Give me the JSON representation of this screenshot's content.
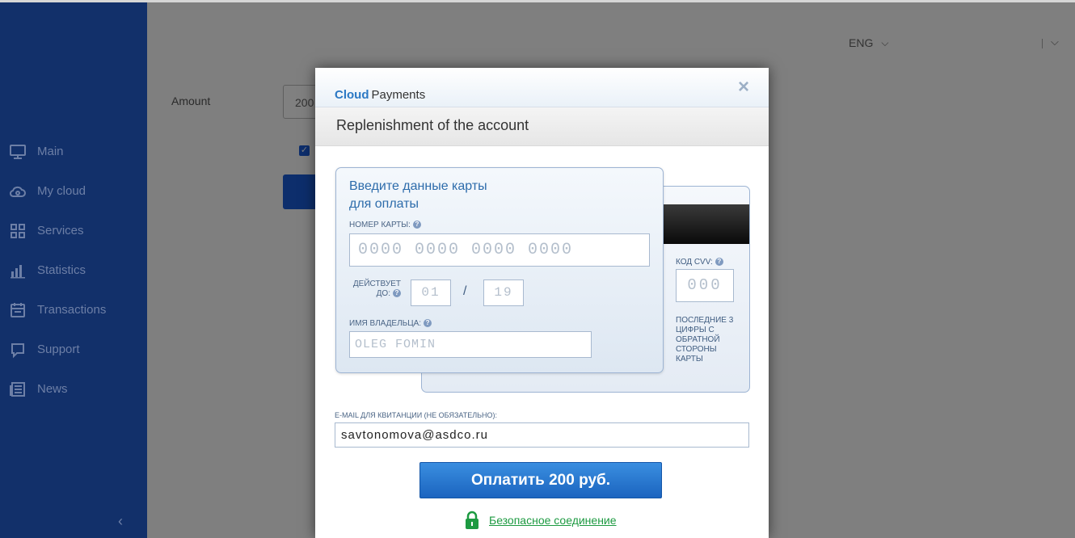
{
  "sidebar": {
    "items": [
      {
        "label": "Main",
        "icon": "monitor-icon"
      },
      {
        "label": "My cloud",
        "icon": "cloud-icon"
      },
      {
        "label": "Services",
        "icon": "grid-icon"
      },
      {
        "label": "Statistics",
        "icon": "bar-chart-icon"
      },
      {
        "label": "Transactions",
        "icon": "calendar-icon"
      },
      {
        "label": "Support",
        "icon": "chat-icon"
      },
      {
        "label": "News",
        "icon": "newspaper-icon"
      }
    ],
    "collapse_glyph": "‹"
  },
  "header": {
    "language": "ENG",
    "chevron": "⌵"
  },
  "form": {
    "amount_label": "Amount",
    "amount_value": "200",
    "check_glyph": "✓"
  },
  "modal": {
    "brand_cloud": "Cloud",
    "brand_payments": "Payments",
    "close_glyph": "×",
    "title": "Replenishment of the account",
    "card_title_line1": "Введите данные карты",
    "card_title_line2": "для оплаты",
    "card_number_label": "НОМЕР КАРТЫ:",
    "card_number_placeholder": "0000 0000 0000 0000",
    "expiry_label_line1": "ДЕЙСТВУЕТ",
    "expiry_label_line2": "ДО:",
    "expiry_month_placeholder": "01",
    "expiry_year_placeholder": "19",
    "expiry_separator": "/",
    "holder_label": "ИМЯ ВЛАДЕЛЬЦА:",
    "holder_placeholder": "OLEG FOMIN",
    "cvv_label": "КОД CVV:",
    "cvv_placeholder": "000",
    "cvv_note": "ПОСЛЕДНИЕ 3 ЦИФРЫ С ОБРАТНОЙ СТОРОНЫ КАРТЫ",
    "help_glyph": "?",
    "email_label": "E-MAIL ДЛЯ КВИТАНЦИИ (НЕ ОБЯЗАТЕЛЬНО):",
    "email_value": "savtonomova@asdco.ru",
    "pay_button": "Оплатить 200 руб.",
    "secure_link": "Безопасное соединение"
  },
  "colors": {
    "sidebar_bg": "#12306a",
    "overlay_bg": "#7f7f7f",
    "pay_button": "#1b64bf",
    "secure_link": "#1d9a41"
  }
}
